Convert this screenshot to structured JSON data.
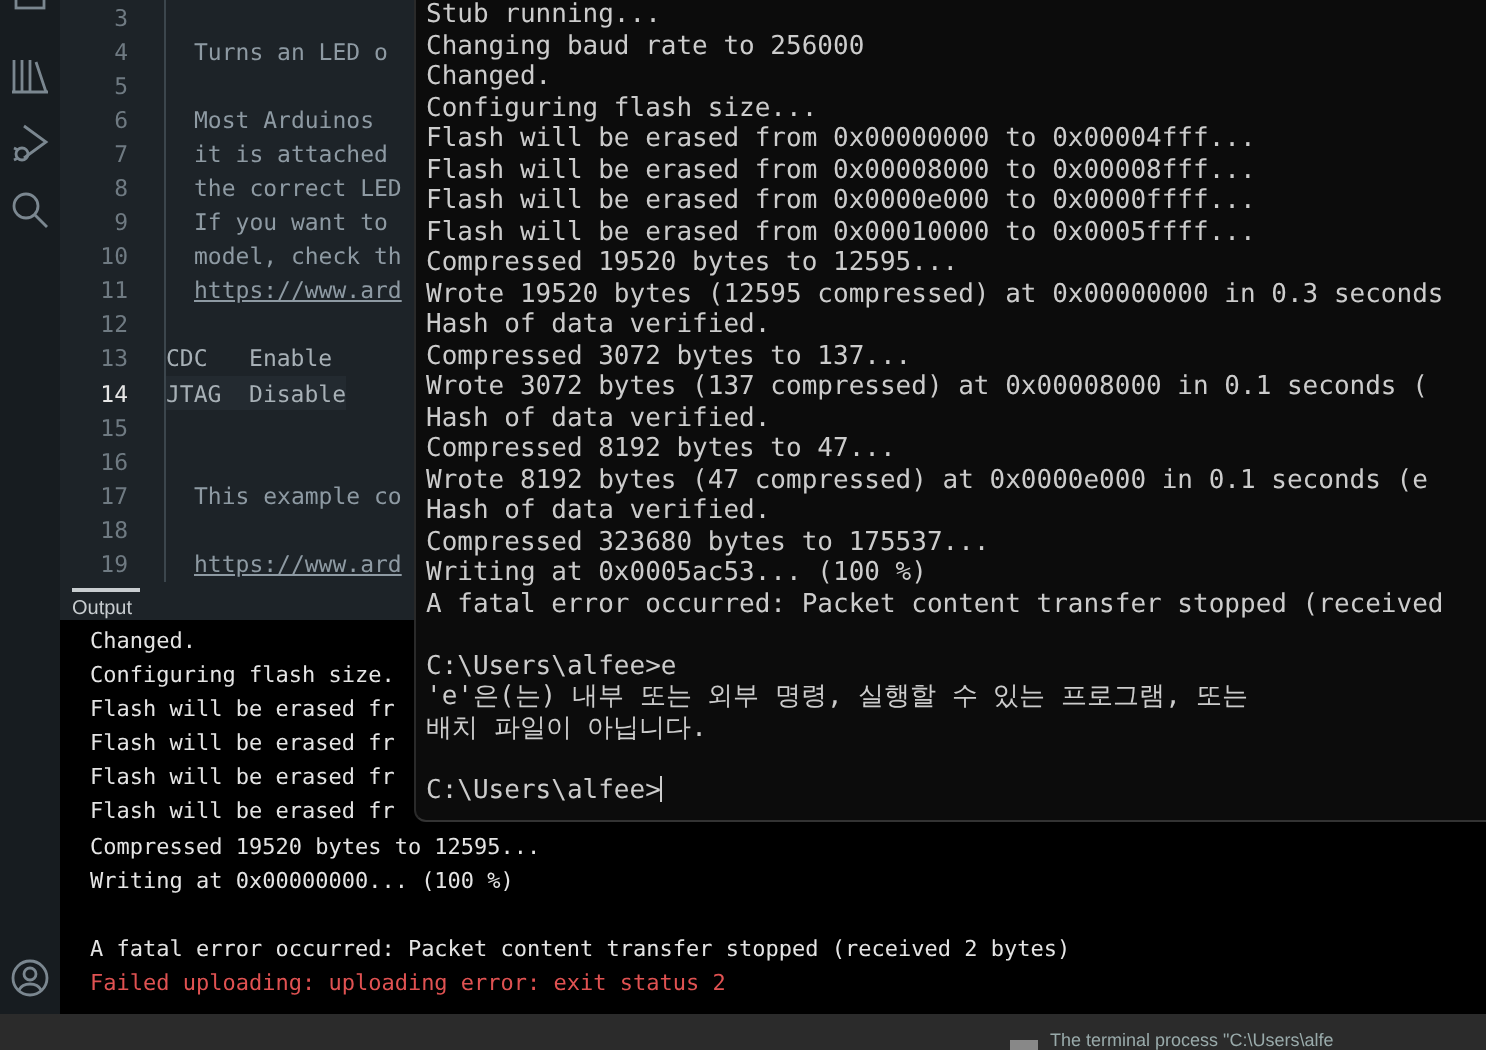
{
  "editor": {
    "lines": [
      {
        "number": "3",
        "kind": "code",
        "current": false
      },
      {
        "number": "4",
        "kind": "code",
        "text": "Turns an LED o",
        "current": false
      },
      {
        "number": "5",
        "kind": "code",
        "current": false
      },
      {
        "number": "6",
        "kind": "code",
        "text": "Most Arduinos",
        "current": false
      },
      {
        "number": "7",
        "kind": "code",
        "text": "it is attached",
        "current": false
      },
      {
        "number": "8",
        "kind": "code",
        "text": "the correct LED",
        "current": false
      },
      {
        "number": "9",
        "kind": "code",
        "text": "If you want to",
        "current": false
      },
      {
        "number": "10",
        "kind": "code",
        "text": "model, check th",
        "current": false
      },
      {
        "number": "11",
        "kind": "link",
        "text": "https://www.ard",
        "current": false
      },
      {
        "number": "12",
        "kind": "code",
        "current": false
      },
      {
        "number": "13",
        "kind": "setting",
        "text": "CDC   Enable",
        "current": false
      },
      {
        "number": "14",
        "kind": "setting",
        "text": "JTAG  Disable",
        "current": true
      },
      {
        "number": "15",
        "kind": "code",
        "current": false
      },
      {
        "number": "16",
        "kind": "code",
        "current": false
      },
      {
        "number": "17",
        "kind": "code",
        "text": "This example co",
        "current": false
      },
      {
        "number": "18",
        "kind": "code",
        "current": false
      },
      {
        "number": "19",
        "kind": "link",
        "text": "https://www.ard",
        "current": false
      }
    ]
  },
  "output": {
    "tab": "Output",
    "lines": [
      {
        "kind": "info",
        "text": "Changed."
      },
      {
        "kind": "info",
        "text": "Configuring flash size."
      },
      {
        "kind": "info",
        "text": "Flash will be erased fr"
      },
      {
        "kind": "info",
        "text": "Flash will be erased fr"
      },
      {
        "kind": "info",
        "text": "Flash will be erased fr"
      },
      {
        "kind": "info",
        "text": "Flash will be erased fr"
      },
      {
        "kind": "info",
        "text": "Compressed 19520 bytes to 12595..."
      },
      {
        "kind": "info",
        "text": "Writing at 0x00000000... (100 %)"
      },
      {
        "kind": "blank"
      },
      {
        "kind": "info",
        "text": "A fatal error occurred: Packet content transfer stopped (received 2 bytes)"
      },
      {
        "kind": "error",
        "text": "Failed uploading: uploading error: exit status 2"
      }
    ]
  },
  "terminal": {
    "lines": [
      {
        "kind": "info",
        "text": "Stub running..."
      },
      {
        "kind": "info",
        "text": "Changing baud rate to 256000"
      },
      {
        "kind": "info",
        "text": "Changed."
      },
      {
        "kind": "info",
        "text": "Configuring flash size..."
      },
      {
        "kind": "info",
        "text": "Flash will be erased from 0x00000000 to 0x00004fff..."
      },
      {
        "kind": "info",
        "text": "Flash will be erased from 0x00008000 to 0x00008fff..."
      },
      {
        "kind": "info",
        "text": "Flash will be erased from 0x0000e000 to 0x0000ffff..."
      },
      {
        "kind": "info",
        "text": "Flash will be erased from 0x00010000 to 0x0005ffff..."
      },
      {
        "kind": "info",
        "text": "Compressed 19520 bytes to 12595..."
      },
      {
        "kind": "info",
        "text": "Wrote 19520 bytes (12595 compressed) at 0x00000000 in 0.3 seconds"
      },
      {
        "kind": "info",
        "text": "Hash of data verified."
      },
      {
        "kind": "info",
        "text": "Compressed 3072 bytes to 137..."
      },
      {
        "kind": "info",
        "text": "Wrote 3072 bytes (137 compressed) at 0x00008000 in 0.1 seconds ("
      },
      {
        "kind": "info",
        "text": "Hash of data verified."
      },
      {
        "kind": "info",
        "text": "Compressed 8192 bytes to 47..."
      },
      {
        "kind": "info",
        "text": "Wrote 8192 bytes (47 compressed) at 0x0000e000 in 0.1 seconds (e"
      },
      {
        "kind": "info",
        "text": "Hash of data verified."
      },
      {
        "kind": "info",
        "text": "Compressed 323680 bytes to 175537..."
      },
      {
        "kind": "info",
        "text": "Writing at 0x0005ac53... (100 %)"
      },
      {
        "kind": "info",
        "text": "A fatal error occurred: Packet content transfer stopped (received"
      },
      {
        "kind": "blank"
      },
      {
        "kind": "info",
        "text": "C:\\Users\\alfee>e"
      },
      {
        "kind": "info",
        "text": "'e'은(는) 내부 또는 외부 명령, 실행할 수 있는 프로그램, 또는"
      },
      {
        "kind": "info",
        "text": "배치 파일이 아닙니다."
      },
      {
        "kind": "blank"
      },
      {
        "kind": "prompt",
        "text": "C:\\Users\\alfee>"
      }
    ]
  },
  "status_bar": {
    "message": "The terminal process \"C:\\Users\\alfe"
  }
}
